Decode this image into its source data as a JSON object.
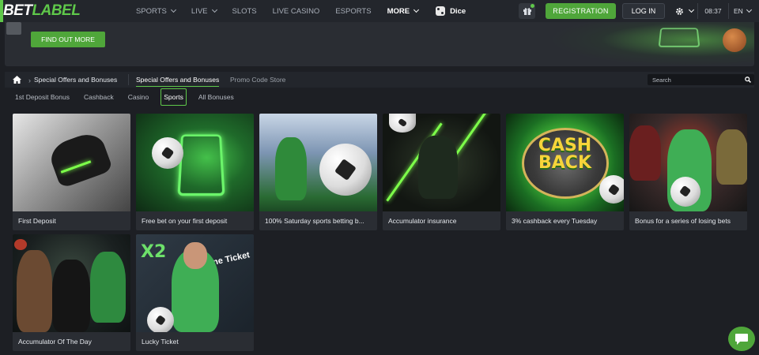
{
  "header": {
    "logo_bet": "BET",
    "logo_label": "LABEL",
    "nav": [
      {
        "label": "SPORTS",
        "has_dropdown": true
      },
      {
        "label": "LIVE",
        "has_dropdown": true
      },
      {
        "label": "SLOTS",
        "has_dropdown": false
      },
      {
        "label": "LIVE CASINO",
        "has_dropdown": false
      },
      {
        "label": "ESPORTS",
        "has_dropdown": false
      },
      {
        "label": "MORE",
        "has_dropdown": true
      }
    ],
    "dice_label": "Dice",
    "registration_label": "REGISTRATION",
    "login_label": "LOG IN",
    "time": "08:37",
    "language": "EN"
  },
  "banner": {
    "cta_label": "FIND OUT MORE"
  },
  "breadcrumb": {
    "current": "Special Offers and Bonuses"
  },
  "top_tabs": [
    {
      "label": "Special Offers and Bonuses",
      "active": true
    },
    {
      "label": "Promo Code Store",
      "active": false
    }
  ],
  "search": {
    "placeholder": "Search"
  },
  "filters": [
    {
      "label": "1st Deposit Bonus",
      "active": false
    },
    {
      "label": "Cashback",
      "active": false
    },
    {
      "label": "Casino",
      "active": false
    },
    {
      "label": "Sports",
      "active": true
    },
    {
      "label": "All Bonuses",
      "active": false
    }
  ],
  "cards": [
    {
      "title": "First Deposit"
    },
    {
      "title": "Free bet on your first deposit"
    },
    {
      "title": "100% Saturday sports betting b..."
    },
    {
      "title": "Accumulator insurance"
    },
    {
      "title": "3% cashback every Tuesday"
    },
    {
      "title": "Bonus for a series of losing bets"
    },
    {
      "title": "Accumulator Of The Day"
    },
    {
      "title": "Lucky Ticket"
    }
  ],
  "card_art": {
    "cashback_line1": "CASH",
    "cashback_line2": "BACK",
    "lucky_x2": "X2",
    "lucky_ticket": "Fortune Ticket"
  },
  "colors": {
    "accent_green": "#4fa63a",
    "brand_green": "#5fc84a",
    "background": "#1d1f24"
  }
}
